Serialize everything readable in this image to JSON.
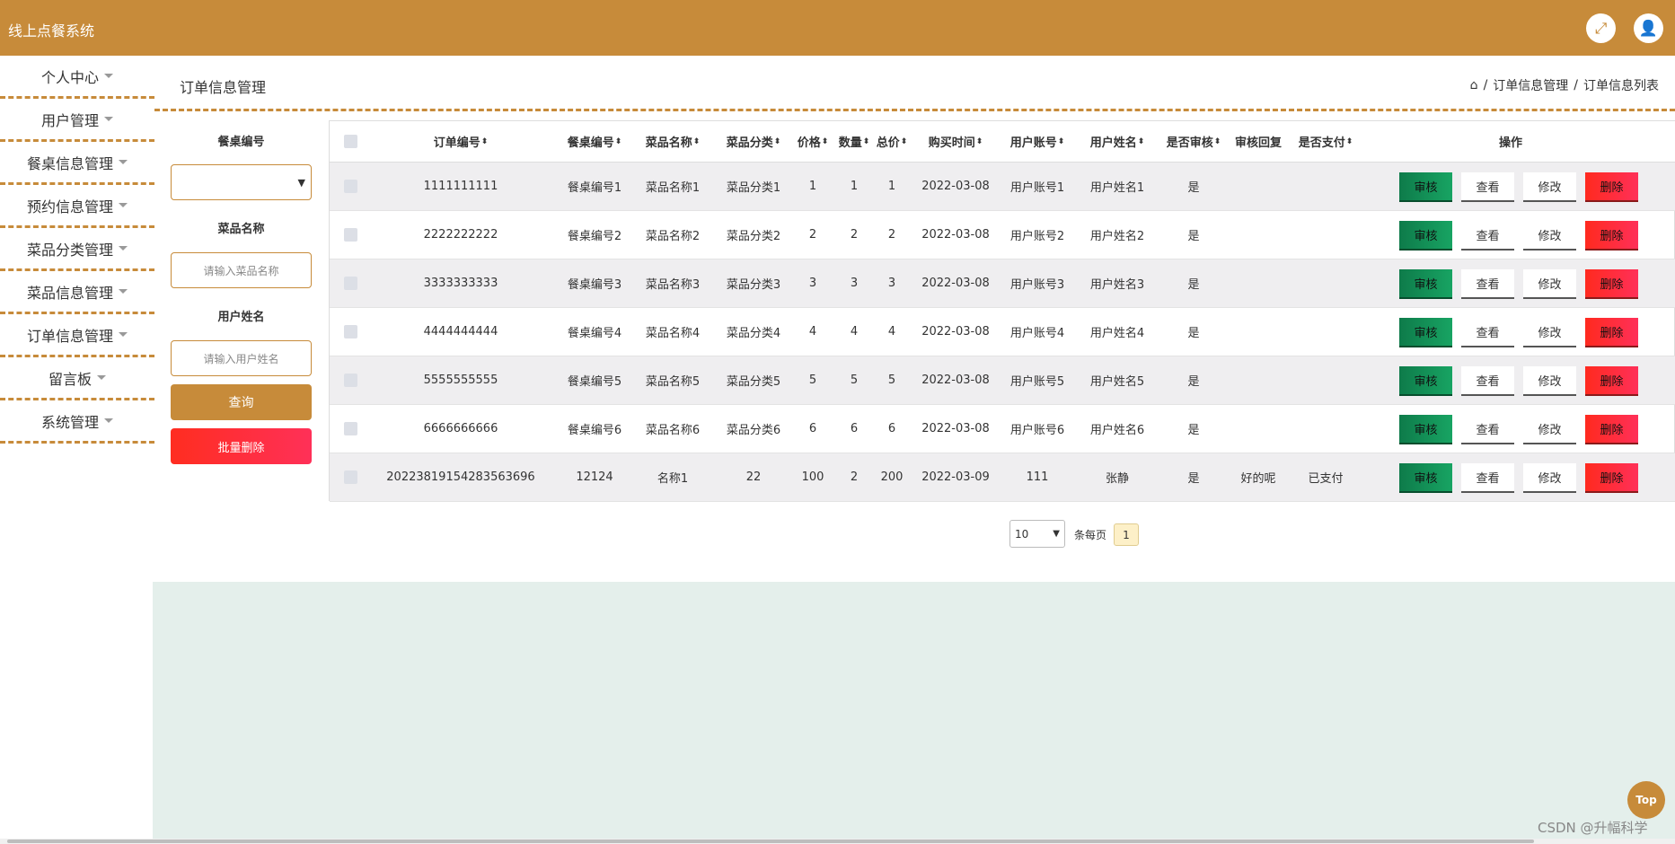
{
  "app": {
    "title": "线上点餐系统"
  },
  "header_icons": [
    "fullscreen-icon",
    "user-icon"
  ],
  "sidebar": {
    "items": [
      {
        "label": "个人中心"
      },
      {
        "label": "用户管理"
      },
      {
        "label": "餐桌信息管理"
      },
      {
        "label": "预约信息管理"
      },
      {
        "label": "菜品分类管理"
      },
      {
        "label": "菜品信息管理"
      },
      {
        "label": "订单信息管理"
      },
      {
        "label": "留言板"
      },
      {
        "label": "系统管理"
      }
    ]
  },
  "page": {
    "title": "订单信息管理",
    "breadcrumb": [
      "订单信息管理",
      "订单信息列表"
    ]
  },
  "filters": {
    "table_label": "餐桌编号",
    "table_value": "",
    "dish_label": "菜品名称",
    "dish_placeholder": "请输入菜品名称",
    "user_label": "用户姓名",
    "user_placeholder": "请输入用户姓名",
    "query_label": "查询",
    "bulk_delete_label": "批量删除"
  },
  "table": {
    "columns": [
      "订单编号",
      "餐桌编号",
      "菜品名称",
      "菜品分类",
      "价格",
      "数量",
      "总价",
      "购买时间",
      "用户账号",
      "用户姓名",
      "是否审核",
      "审核回复",
      "是否支付",
      "操作"
    ],
    "sortable": [
      true,
      true,
      true,
      true,
      true,
      true,
      true,
      true,
      true,
      true,
      true,
      false,
      true,
      false
    ],
    "actions": {
      "audit": "审核",
      "view": "查看",
      "edit": "修改",
      "delete": "删除"
    },
    "rows": [
      [
        "1111111111",
        "餐桌编号1",
        "菜品名称1",
        "菜品分类1",
        "1",
        "1",
        "1",
        "2022-03-08",
        "用户账号1",
        "用户姓名1",
        "是",
        "",
        ""
      ],
      [
        "2222222222",
        "餐桌编号2",
        "菜品名称2",
        "菜品分类2",
        "2",
        "2",
        "2",
        "2022-03-08",
        "用户账号2",
        "用户姓名2",
        "是",
        "",
        ""
      ],
      [
        "3333333333",
        "餐桌编号3",
        "菜品名称3",
        "菜品分类3",
        "3",
        "3",
        "3",
        "2022-03-08",
        "用户账号3",
        "用户姓名3",
        "是",
        "",
        ""
      ],
      [
        "4444444444",
        "餐桌编号4",
        "菜品名称4",
        "菜品分类4",
        "4",
        "4",
        "4",
        "2022-03-08",
        "用户账号4",
        "用户姓名4",
        "是",
        "",
        ""
      ],
      [
        "5555555555",
        "餐桌编号5",
        "菜品名称5",
        "菜品分类5",
        "5",
        "5",
        "5",
        "2022-03-08",
        "用户账号5",
        "用户姓名5",
        "是",
        "",
        ""
      ],
      [
        "6666666666",
        "餐桌编号6",
        "菜品名称6",
        "菜品分类6",
        "6",
        "6",
        "6",
        "2022-03-08",
        "用户账号6",
        "用户姓名6",
        "是",
        "",
        ""
      ],
      [
        "20223819154283563696",
        "12124",
        "名称1",
        "22",
        "100",
        "2",
        "200",
        "2022-03-09",
        "111",
        "张静",
        "是",
        "好的呢",
        "已支付"
      ]
    ]
  },
  "pager": {
    "page_size": "10",
    "per_page_text": "条每页",
    "current_page": "1"
  },
  "misc": {
    "top_label": "Top",
    "watermark": "CSDN @升幅科学"
  },
  "colors": {
    "brand": "#c78b3a",
    "audit": "#18a463",
    "danger": "#ff2d20"
  }
}
